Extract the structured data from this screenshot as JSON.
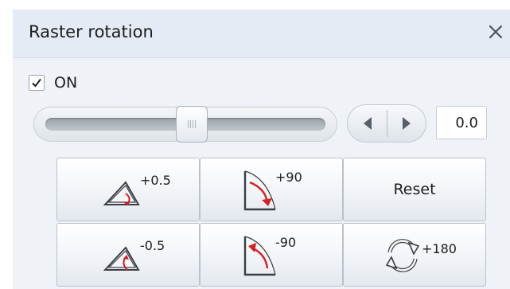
{
  "window": {
    "title": "Raster rotation",
    "close_icon": "close-icon"
  },
  "toggle": {
    "label": "ON",
    "checked": true
  },
  "slider": {
    "value_fraction": 0.5
  },
  "angle_field": {
    "value": "0.0"
  },
  "buttons": {
    "rotate_ccw_half": {
      "label": "+0.5",
      "icon": "rotate-small-ccw-icon"
    },
    "rotate_ccw_90": {
      "label": "+90",
      "icon": "rotate-90-ccw-icon"
    },
    "reset": {
      "label": "Reset"
    },
    "rotate_cw_half": {
      "label": "-0.5",
      "icon": "rotate-small-cw-icon"
    },
    "rotate_cw_90": {
      "label": "-90",
      "icon": "rotate-90-cw-icon"
    },
    "rotate_180": {
      "label": "+180",
      "icon": "rotate-180-icon"
    }
  },
  "colors": {
    "accent_red": "#d42020",
    "title_bar": "#e4ebf4",
    "panel": "#eff2f7"
  }
}
